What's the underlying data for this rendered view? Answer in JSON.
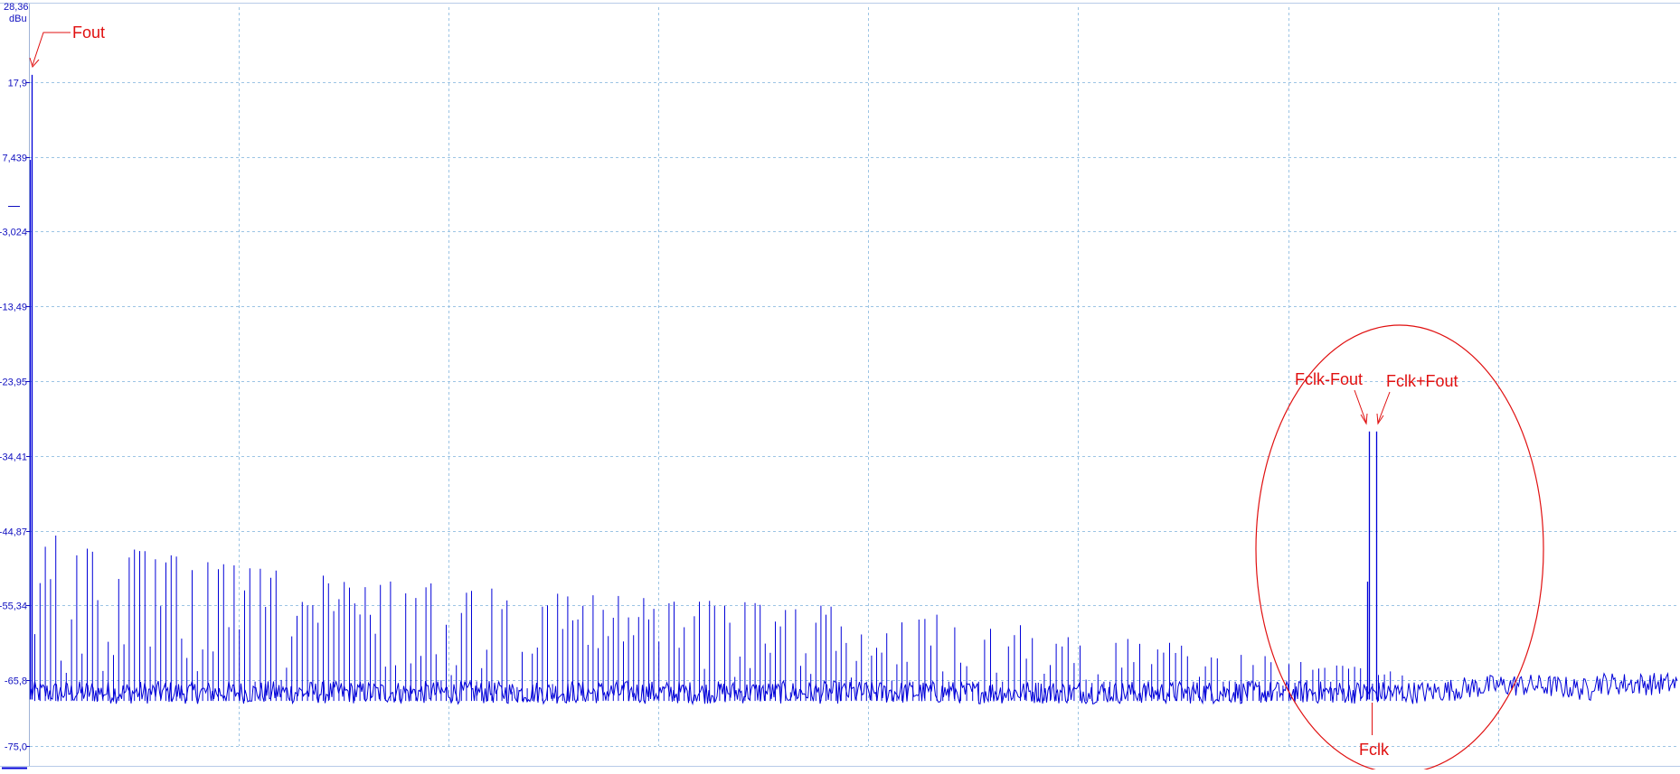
{
  "chart_data": {
    "type": "line",
    "title": "",
    "xlabel": "",
    "ylabel": "dBu",
    "y_unit": "dBu",
    "y_top_label": "28,36",
    "y_ticks": [
      "17,9",
      "7,439",
      "-3,024",
      "-13,49",
      "-23,95",
      "-34,41",
      "-44,87",
      "-55,34",
      "-65,8",
      "-75,0"
    ],
    "ylim": [
      -75.0,
      28.36
    ],
    "x_scale": "log",
    "x_tick_labels": [],
    "grid": true,
    "grid_style": "dashed",
    "line_color": "#0000d8",
    "noise_floor_dbu": -67.5,
    "spectrum_peaks": [
      {
        "label": "Fout",
        "level_dbu": 18.9
      },
      {
        "label": "Fclk-Fout",
        "level_dbu": -31.0
      },
      {
        "label": "Fclk+Fout",
        "level_dbu": -31.0
      },
      {
        "label": "Fclk",
        "level_dbu": -52.0
      }
    ],
    "harmonic_levels_dbu": [
      -45.0,
      -46.5,
      -48.0,
      -49.5,
      -50.5,
      -51.5,
      -52.0,
      -52.5,
      -53.0,
      -53.5,
      -54.0,
      -54.5,
      -55.0,
      -55.5,
      -56.0,
      -57.0,
      -58.0,
      -59.0,
      -60.0,
      -61.5,
      -62.5,
      -63.5,
      -64.5
    ]
  },
  "annotations": {
    "fout": "Fout",
    "fclk_minus_fout": "Fclk-Fout",
    "fclk_plus_fout": "Fclk+Fout",
    "fclk": "Fclk"
  },
  "colors": {
    "trace": "#0000d8",
    "grid": "#9cc4e4",
    "annotation": "#e01010",
    "axis_text": "#1010c0"
  }
}
